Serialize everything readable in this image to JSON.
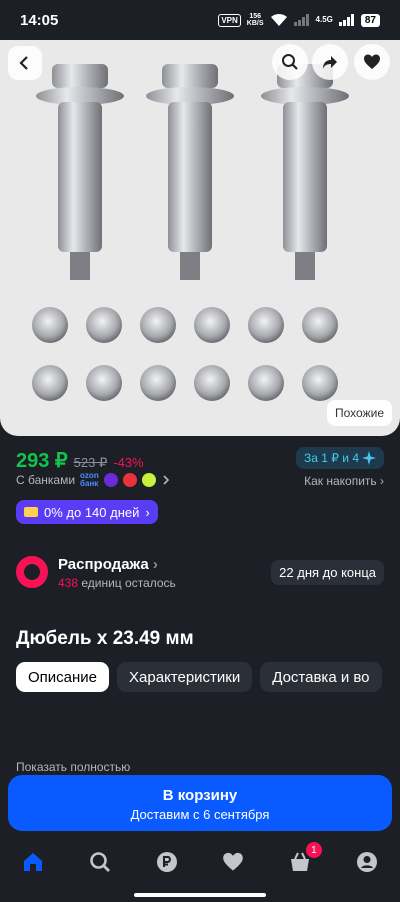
{
  "status": {
    "time": "14:05",
    "vpn": "VPN",
    "speed_value": "156",
    "speed_unit": "KB/S",
    "network": "4.5G",
    "battery": "87"
  },
  "gallery": {
    "similar_label": "Похожие"
  },
  "price": {
    "current": "293 ₽",
    "old": "523 ₽",
    "discount": "-43%",
    "points_label": "За 1 ₽ и 4",
    "banks_label": "С банками",
    "ozon_bank_top": "ozon",
    "ozon_bank_bottom": "банк",
    "save_link": "Как накопить",
    "installment": "0% до 140 дней"
  },
  "sale": {
    "title": "Распродажа",
    "count": "438",
    "count_suffix": " единиц осталось",
    "days_left": "22 дня до конца"
  },
  "product": {
    "title": "Дюбель x 23.49 мм",
    "tabs": [
      {
        "label": "Описание",
        "active": true
      },
      {
        "label": "Характеристики",
        "active": false
      },
      {
        "label": "Доставка и во",
        "active": false
      }
    ],
    "show_all": "Показать полностью"
  },
  "cart": {
    "label": "В корзину",
    "delivery": "Доставим с 6 сентября"
  },
  "nav": {
    "cart_badge": "1",
    "icons": [
      "home-icon",
      "search-icon",
      "ruble-icon",
      "heart-icon",
      "cart-icon",
      "profile-icon"
    ]
  },
  "colors": {
    "price_green": "#10c44c",
    "discount_pink": "#f91155",
    "primary_blue": "#0a5bff",
    "installment_purple": "#5a3cf5"
  }
}
